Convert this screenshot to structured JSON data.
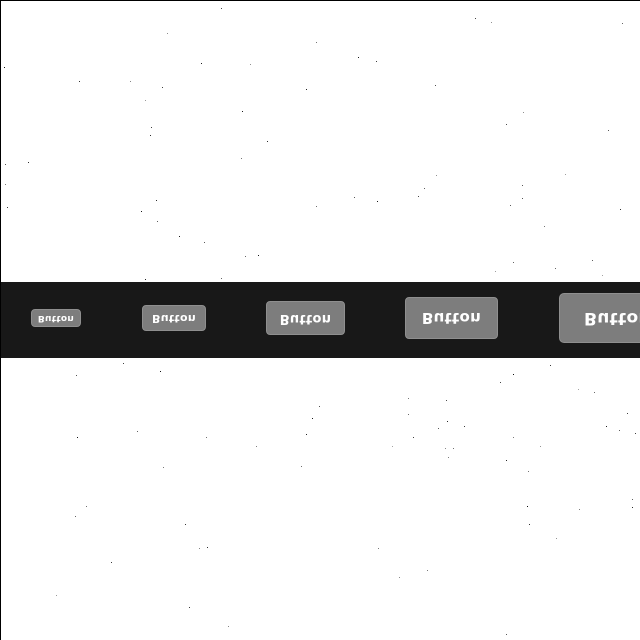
{
  "toolbar": {
    "buttons": [
      {
        "label": "Button"
      },
      {
        "label": "Button"
      },
      {
        "label": "Button"
      },
      {
        "label": "Button"
      },
      {
        "label": "Button"
      }
    ]
  },
  "colors": {
    "page_background": "#ffffff",
    "toolbar_background": "#181818",
    "button_background": "#7d7d7d",
    "button_text": "#ffffff"
  }
}
